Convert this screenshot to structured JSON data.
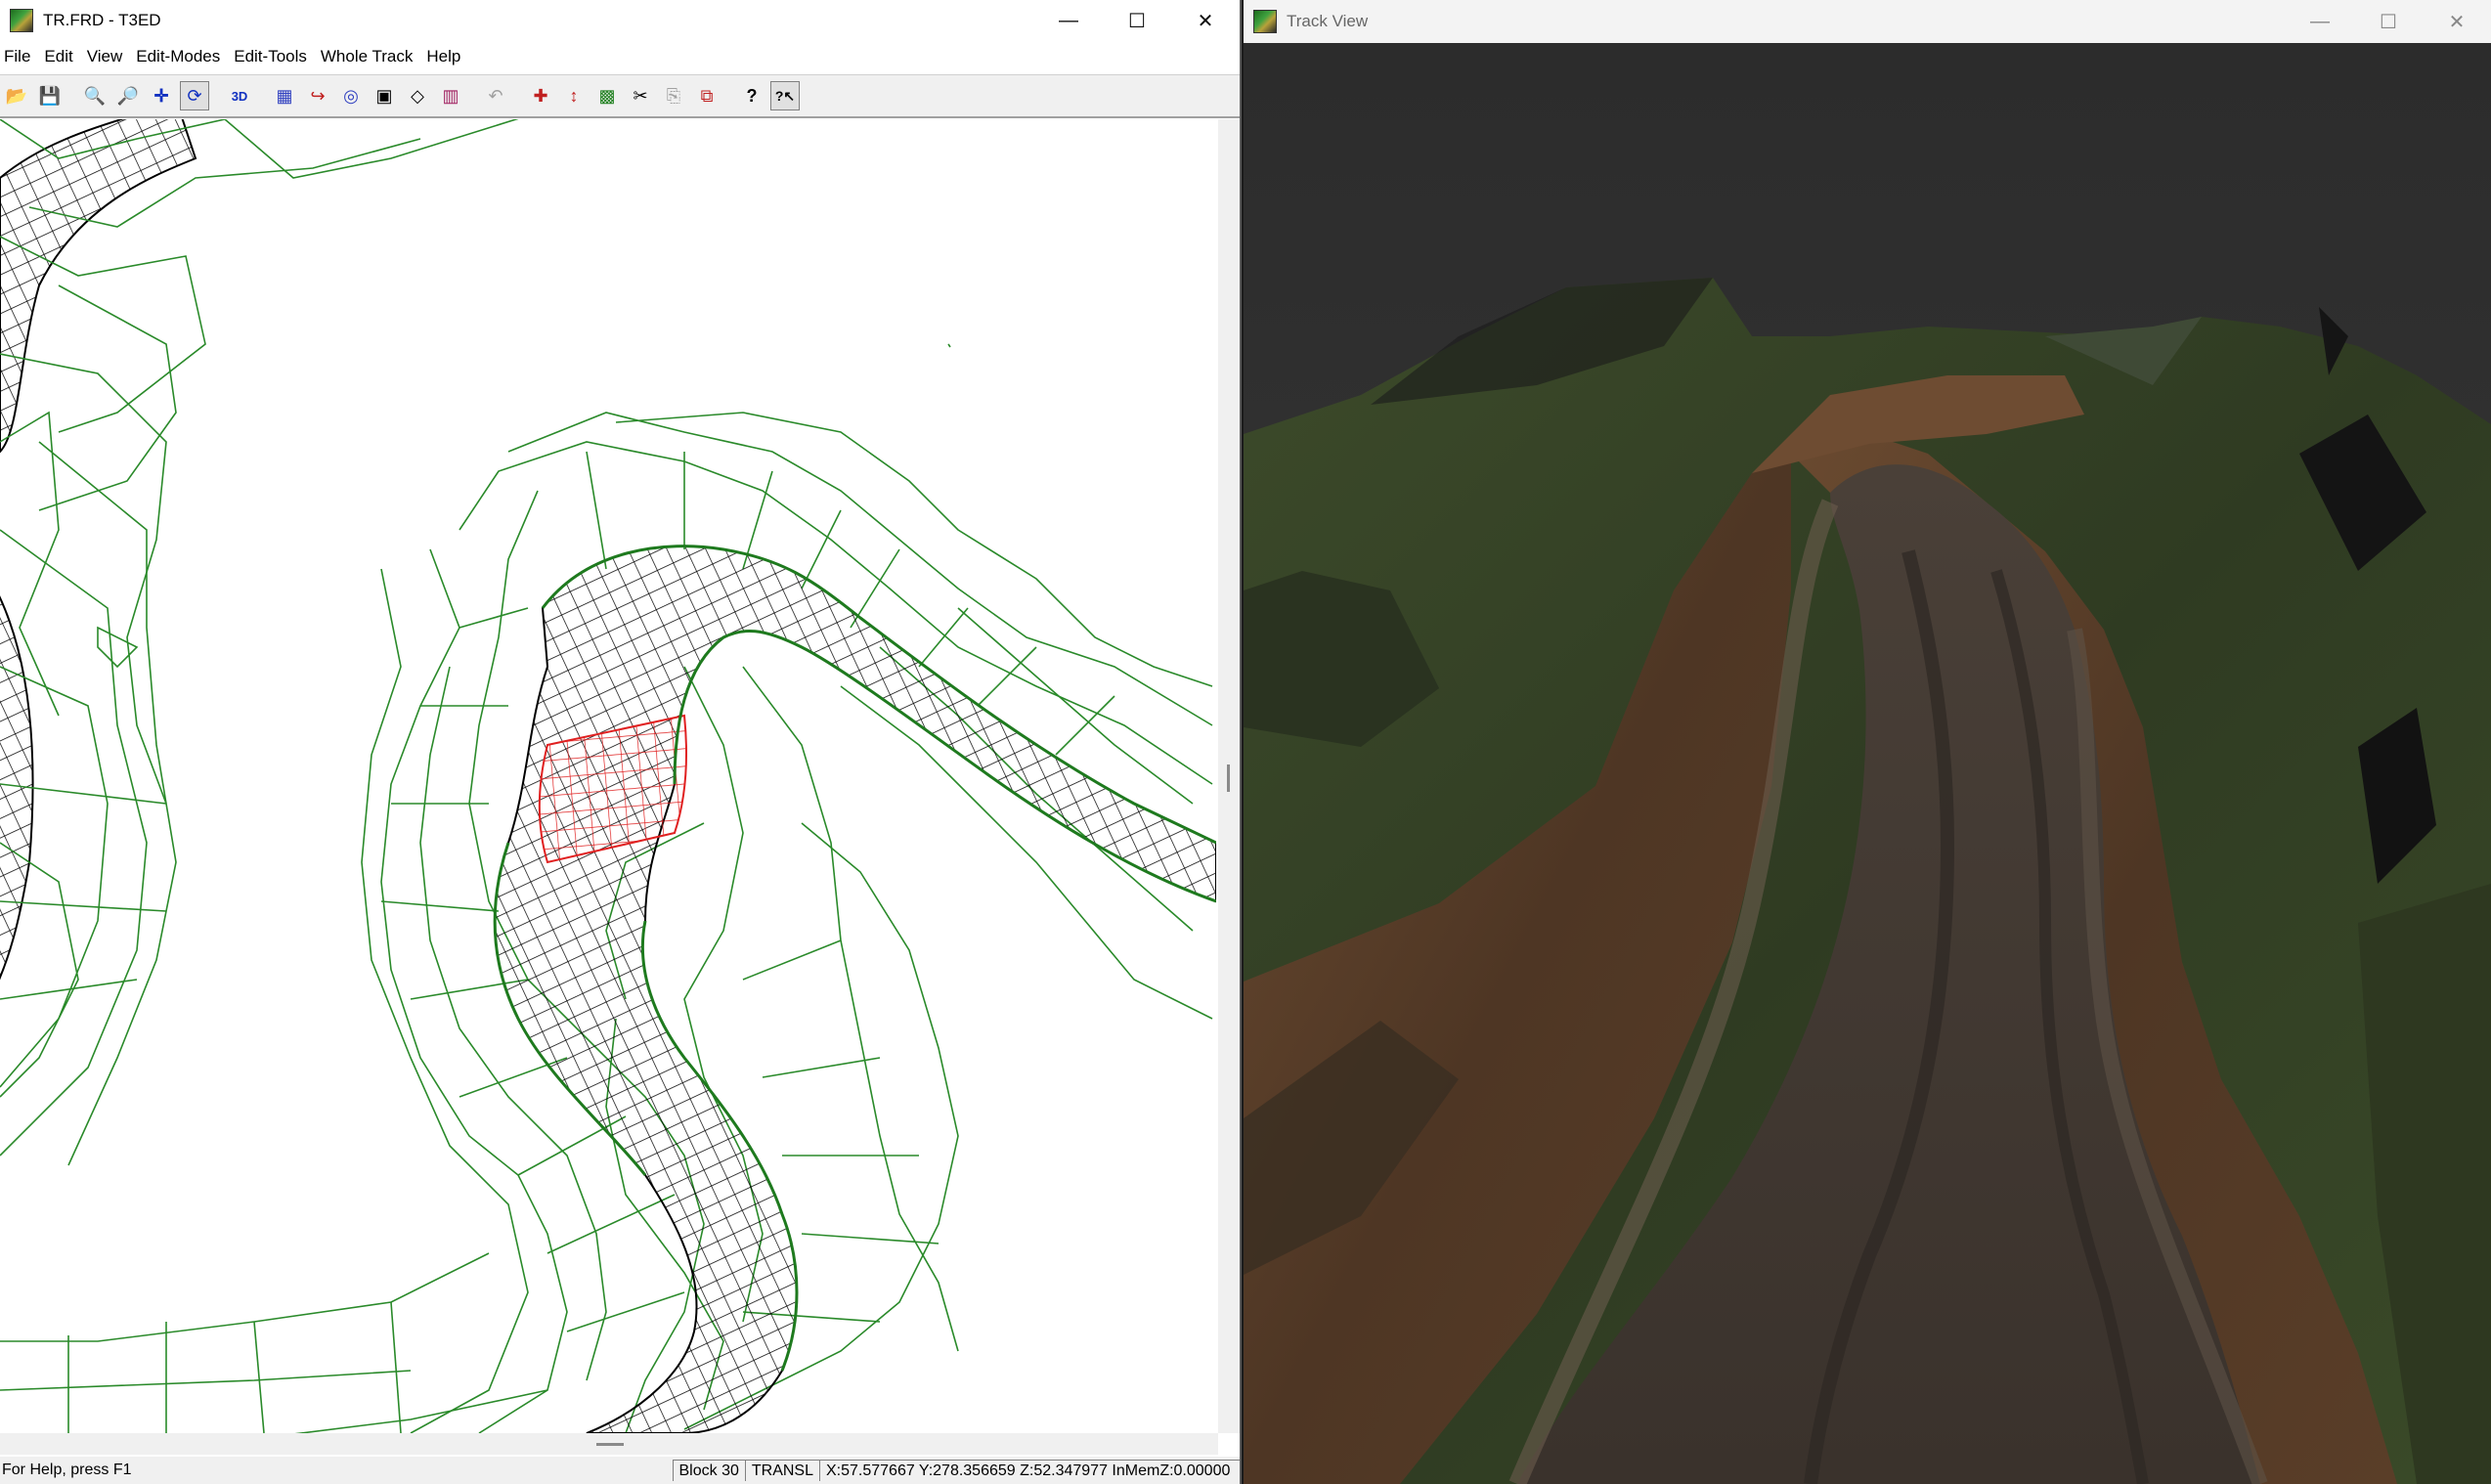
{
  "left_window": {
    "title": "TR.FRD - T3ED",
    "controls": {
      "minimize": "—",
      "maximize": "☐",
      "close": "✕"
    },
    "menu": [
      "File",
      "Edit",
      "View",
      "Edit-Modes",
      "Edit-Tools",
      "Whole Track",
      "Help"
    ],
    "toolbar_icons": [
      "open-icon",
      "save-icon",
      "zoom-in-icon",
      "zoom-out-icon",
      "move-icon",
      "rotate-icon",
      "3d-view-icon",
      "grid-icon",
      "curve-icon",
      "objects-icon",
      "cube-icon",
      "polygon-icon",
      "texture-icon",
      "undo-icon",
      "cross-move-icon",
      "vertical-move-icon",
      "image-icon",
      "cut-icon",
      "copy-icon",
      "paste-icon",
      "help-icon",
      "context-help-icon"
    ],
    "toolbar_glyphs": [
      "📂",
      "💾",
      "🔍",
      "🔎",
      "✛",
      "⟳",
      "3D",
      "▦",
      "↪",
      "◎",
      "▣",
      "◇",
      "▥",
      "↶",
      "✚",
      "↕",
      "▩",
      "✂",
      "⎘",
      "⧉",
      "?",
      "?↖"
    ],
    "status": {
      "help": "For Help, press F1",
      "block": "Block 30",
      "mode": "TRANSL",
      "coords": "X:57.577667 Y:278.356659 Z:52.347977 InMemZ:0.00000"
    },
    "colors": {
      "wire_green": "#2a8a2a",
      "road_mesh": "#000000",
      "selected": "#e02020"
    }
  },
  "right_window": {
    "title": "Track View",
    "controls": {
      "minimize": "—",
      "maximize": "☐",
      "close": "✕"
    }
  }
}
